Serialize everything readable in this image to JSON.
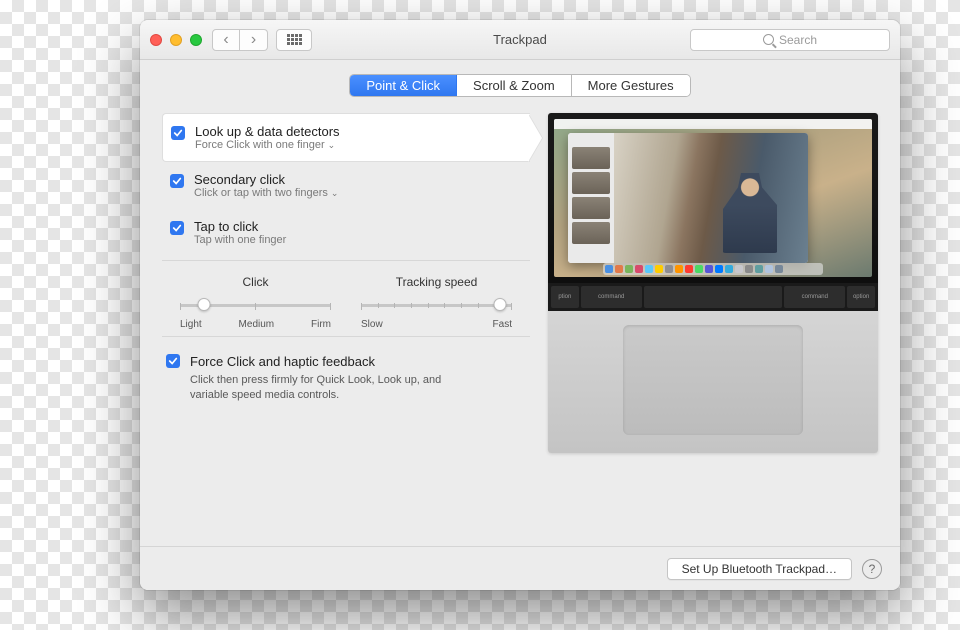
{
  "window": {
    "title": "Trackpad"
  },
  "search": {
    "placeholder": "Search"
  },
  "tabs": [
    {
      "label": "Point & Click",
      "active": true
    },
    {
      "label": "Scroll & Zoom",
      "active": false
    },
    {
      "label": "More Gestures",
      "active": false
    }
  ],
  "options": {
    "lookup": {
      "label": "Look up & data detectors",
      "sub": "Force Click with one finger",
      "checked": true,
      "dropdown": true,
      "selected": true
    },
    "secondary": {
      "label": "Secondary click",
      "sub": "Click or tap with two fingers",
      "checked": true,
      "dropdown": true
    },
    "tap": {
      "label": "Tap to click",
      "sub": "Tap with one finger",
      "checked": true,
      "dropdown": false
    }
  },
  "sliders": {
    "click": {
      "header": "Click",
      "labels": [
        "Light",
        "Medium",
        "Firm"
      ],
      "value_pct": 16
    },
    "tracking": {
      "header": "Tracking speed",
      "labels": [
        "Slow",
        "Fast"
      ],
      "value_pct": 92
    }
  },
  "force": {
    "label": "Force Click and haptic feedback",
    "sub": "Click then press firmly for Quick Look, Look up, and variable speed media controls.",
    "checked": true
  },
  "footer": {
    "bluetooth": "Set Up Bluetooth Trackpad…",
    "help": "?"
  },
  "icons": {
    "back": "‹",
    "fwd": "›"
  },
  "keys": [
    "ption",
    "command",
    "",
    "command",
    "option"
  ]
}
